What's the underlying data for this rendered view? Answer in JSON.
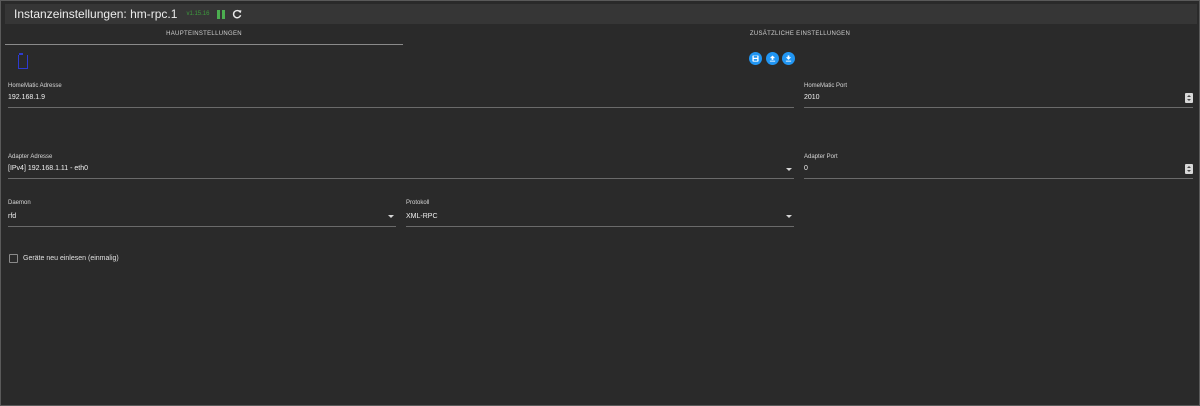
{
  "header": {
    "title": "Instanzeinstellungen: hm-rpc.1",
    "version": "v1.15.16"
  },
  "tabs": [
    {
      "label": "HAUPTEINSTELLUNGEN",
      "active": true
    },
    {
      "label": "ZUSÄTZLICHE EINSTELLUNGEN",
      "active": false
    }
  ],
  "toolbar": {
    "buttons": [
      {
        "icon": "save-icon"
      },
      {
        "icon": "upload-icon"
      },
      {
        "icon": "download-icon"
      }
    ],
    "accent_color": "#2196f3"
  },
  "fields": {
    "homematic_address": {
      "label": "HomeMatic Adresse",
      "value": "192.168.1.9"
    },
    "homematic_port": {
      "label": "HomeMatic Port",
      "value": "2010"
    },
    "adapter_address": {
      "label": "Adapter Adresse",
      "value": "[IPv4] 192.168.1.11 - eth0"
    },
    "adapter_port": {
      "label": "Adapter Port",
      "value": "0"
    },
    "daemon": {
      "label": "Daemon",
      "value": "rfd"
    },
    "protocol": {
      "label": "Protokoll",
      "value": "XML-RPC"
    }
  },
  "checkbox": {
    "label": "Geräte neu einlesen (einmalig)",
    "checked": false
  }
}
